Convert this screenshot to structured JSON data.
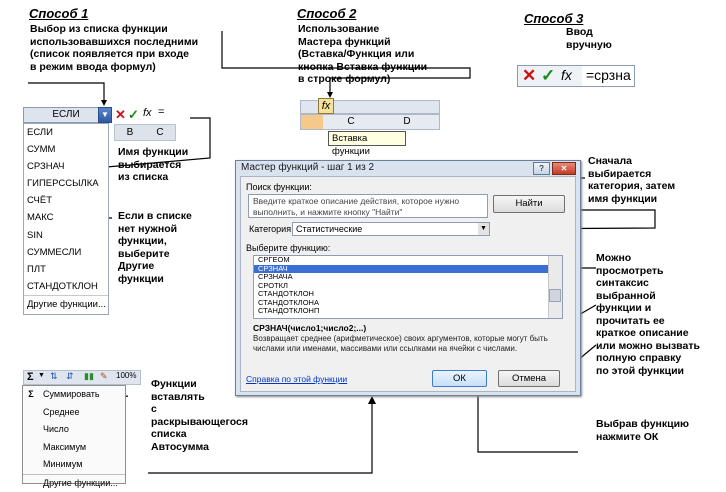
{
  "captions": {
    "m1": "Способ 1",
    "m2": "Способ 2",
    "m3": "Способ 3"
  },
  "notes": {
    "m1_intro": [
      "Выбор из списка функции",
      "использовавшихся последними",
      "(список появляется при входе",
      "в режим ввода формул)"
    ],
    "m2_intro": [
      "Использование",
      "Мастера функций",
      "(Вставка/Функция  или",
      "кнопка Вставка функции",
      "в строке формул)"
    ],
    "m3_intro": [
      "Ввод",
      "вручную"
    ],
    "fn_name": [
      "Имя функции",
      "выбирается",
      "из списка"
    ],
    "not_in_list": [
      "Если в списке",
      "нет нужной",
      "функции,",
      "выберите",
      "Другие",
      "функции"
    ],
    "category_first": [
      "Сначала",
      "выбирается",
      "категория, затем",
      "имя функции"
    ],
    "syntax_help": [
      "Можно",
      "просмотреть",
      "синтаксис",
      "выбранной",
      "функции и",
      "прочитать ее",
      "краткое описание",
      "или можно вызвать",
      "полную справку",
      "по этой функции"
    ],
    "ok_note": [
      "Выбрав функцию",
      "нажмите ОК"
    ],
    "autosum": [
      "Функции",
      "вставлять",
      "с",
      "раскрывающегося",
      "списка",
      "Автосумма"
    ]
  },
  "method1": {
    "dropdown_value": "ЕСЛИ",
    "formula_bar": {
      "cancel_icon": "✕",
      "enter_icon": "✓",
      "fx_label": "fx",
      "equals": "="
    },
    "columns": [
      "B",
      "C"
    ],
    "items": [
      "ЕСЛИ",
      "СУММ",
      "СРЗНАЧ",
      "ГИПЕРССЫЛКА",
      "СЧЁТ",
      "МАКС",
      "SIN",
      "СУММЕСЛИ",
      "ПЛТ",
      "СТАНДОТКЛОН"
    ],
    "other_item": "Другие функции..."
  },
  "method2": {
    "fx_label": "fx",
    "columns": [
      "C",
      "D"
    ],
    "tooltip": "Вставка функции"
  },
  "method3": {
    "cancel_icon": "✕",
    "enter_icon": "✓",
    "fx_label": "fx",
    "typed_text": "=срзна"
  },
  "dialog": {
    "title": "Мастер функций - шаг 1 из 2",
    "help_btn": "?",
    "close_btn": "✕",
    "search_label": "Поиск функции:",
    "search_placeholder": "Введите краткое описание действия, которое нужно выполнить, и нажмите кнопку \"Найти\"",
    "find_button": "Найти",
    "category_label": "Категория:",
    "category_value": "Статистические",
    "select_label": "Выберите функцию:",
    "functions": [
      "СРГЕОМ",
      "СРЗНАЧ",
      "СРЗНАЧА",
      "СРОТКЛ",
      "СТАНДОТКЛОН",
      "СТАНДОТКЛОНА",
      "СТАНДОТКЛОНП"
    ],
    "selected_index": 1,
    "syntax": "СРЗНАЧ(число1;число2;...)",
    "description": "Возвращает среднее (арифметическое) своих аргументов, которые могут быть числами или именами, массивами или ссылками на ячейки с числами.",
    "help_link": "Справка по этой функции",
    "ok_button": "ОК",
    "cancel_button": "Отмена"
  },
  "autosum": {
    "toolbar": {
      "sigma": "Σ",
      "zoom": "100%"
    },
    "items": [
      "Суммировать",
      "Среднее",
      "Число",
      "Максимум",
      "Минимум"
    ],
    "other_item": "Другие функции..."
  }
}
